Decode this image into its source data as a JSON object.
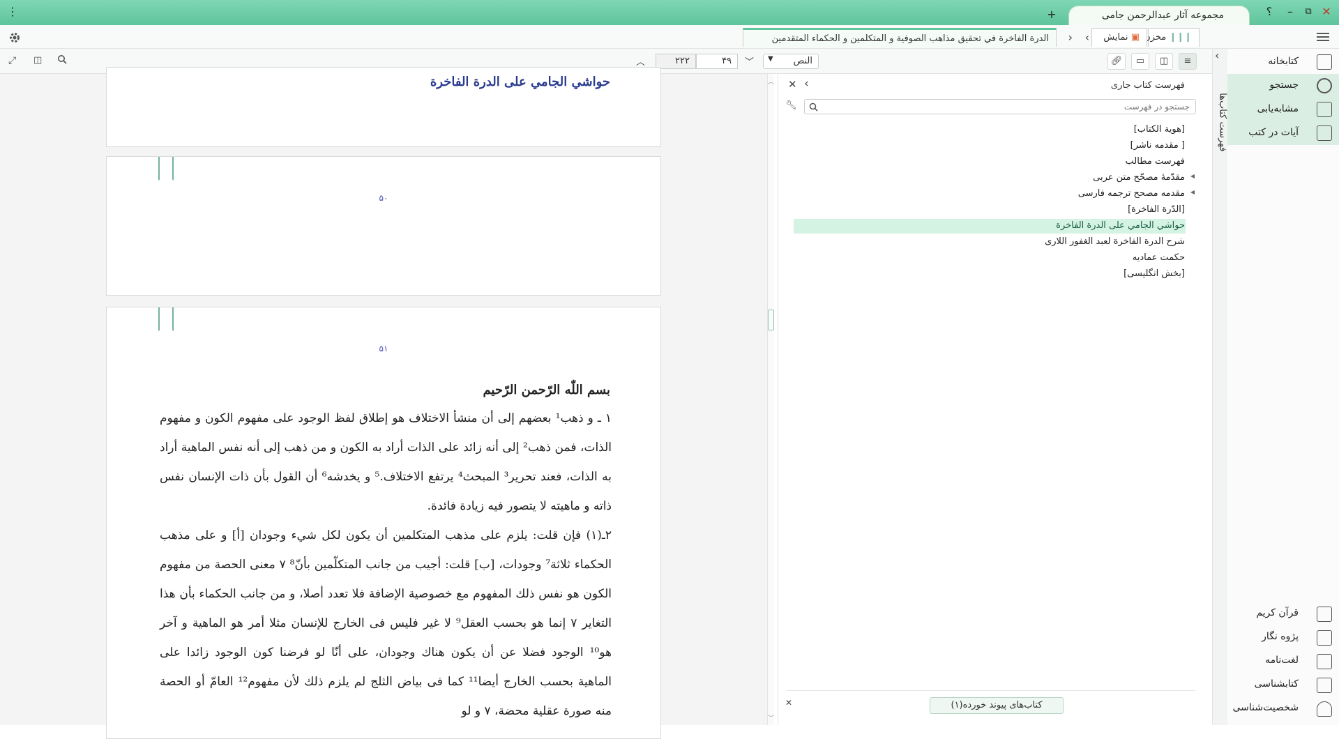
{
  "app": {
    "title": "مجموعه آثار عبدالرحمن جامی",
    "new_tab": "+",
    "help": "؟",
    "min": "–",
    "restore": "⧉",
    "close": "✕",
    "menu_dots": "⋮"
  },
  "tabs": {
    "store": "مخزن",
    "view": "نمایش",
    "document": "الدرة الفاخرة في تحقيق مذاهب الصوفية و المتكلمين و الحكماء المتقدمين"
  },
  "toolbar": {
    "mode": "النص",
    "page_current": "۴۹",
    "page_total": "۲۲۲"
  },
  "document": {
    "heading1": "حواشي الجامي على الدرة الفاخرة",
    "page_num_1": "۵۰",
    "page_num_2": "۵۱",
    "heading2": "بسم اللّٰه الرّحمن الرّحيم",
    "paragraphs": [
      "١ ـ و ذهب¹ بعضهم إلى أن منشأ الاختلاف هو إطلاق لفظ الوجود على مفهوم الكون و مفهوم الذات، فمن ذهب² إلى أنه زائد على الذات أراد به الكون و من ذهب إلى أنه نفس الماهية أراد به الذات، فعند تحرير³ المبحث⁴ يرتفع الاختلاف.⁵ و يخدشه⁶ أن القول بأن ذات الإنسان نفس ذاته و ماهيته لا يتصور فيه زيادة فائدة.",
      "٢ـ(١) فإن قلت: يلزم على مذهب المتكلمين أن يكون لكل شيء وجودان [أ] و على مذهب الحكماء ثلاثة⁷ وجودات، [ب] قلت: أجيب من جانب المتكلّمين بأنّ⁸ ٧ معنى الحصة من مفهوم الكون هو نفس ذلك المفهوم مع خصوصية الإضافة فلا تعدد أصلا، و من جانب الحكماء بأن هذا التغاير ٧ إنما هو بحسب العقل⁹ لا غير فليس فى الخارج للإنسان مثلا أمر هو الماهية و آخر هو¹⁰ الوجود فضلا عن أن يكون هناك وجودان، على أنّا لو فرضنا كون الوجود زائدا على الماهية بحسب الخارج أيضا¹¹ كما فى بياض الثلج لم يلزم ذلك لأن مفهوم¹² العامّ أو الحصة منه صورة عقلية محضة، ٧ و لو"
    ]
  },
  "toc": {
    "title": "فهرست كتاب جارى",
    "search_placeholder": "جستجو در فهرست",
    "items": [
      "[هوية الكتاب]",
      "[ مقدمه ناشر]",
      "فهرست مطالب",
      "مقدّمهٔ مصحّح متن عربی",
      "مقدمه مصحح ترجمه فارسی",
      "[الدّرة الفاخرة]",
      "حواشي الجامي على الدرة الفاخرة",
      "شرح الدرة الفاخرة لعبد الغفور اللاری",
      "حكمت عماديه",
      "[بخش انگلیسی]"
    ],
    "selected_index": 6,
    "linked_books": "کتاب‌های پیوند خورده(۱)"
  },
  "sidebar": {
    "vertical_label": "فهرست کتاب‌ها",
    "items": [
      {
        "label": "کتابخانه"
      },
      {
        "label": "جستجو"
      },
      {
        "label": "مشابه‌یابی"
      },
      {
        "label": "آیات در کتب"
      }
    ],
    "bottom_items": [
      {
        "label": "قرآن کریم"
      },
      {
        "label": "پژوه نگار"
      },
      {
        "label": "لغت‌نامه"
      },
      {
        "label": "کتابشناسی"
      },
      {
        "label": "شخصیت‌شناسی"
      }
    ]
  },
  "colors": {
    "accent": "#5fc49c",
    "highlight": "#d4f3e3",
    "heading": "#2a3b8f"
  }
}
